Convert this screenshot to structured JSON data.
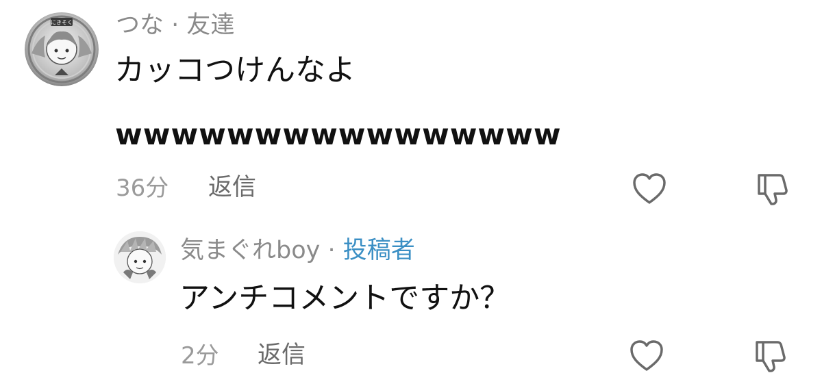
{
  "comments": [
    {
      "author": "つな",
      "separator": " · ",
      "relation": "友達",
      "avatar_badge": "にきそく",
      "lines": [
        "カッコつけんなよ",
        "wwwwwwwwwwwwwwww"
      ],
      "time": "36分",
      "reply_label": "返信",
      "like_icon": "heart-icon",
      "dislike_icon": "thumbs-down-icon"
    },
    {
      "author": "気まぐれboy",
      "separator": " · ",
      "relation": "投稿者",
      "text": "アンチコメントですか？",
      "time": "2分",
      "reply_label": "返信",
      "like_icon": "heart-icon",
      "dislike_icon": "thumbs-down-icon"
    }
  ],
  "colors": {
    "meta_gray": "#8a8a8a",
    "poster_blue": "#3b8fc4",
    "text": "#111111",
    "icon_gray": "#6a6a6a"
  }
}
